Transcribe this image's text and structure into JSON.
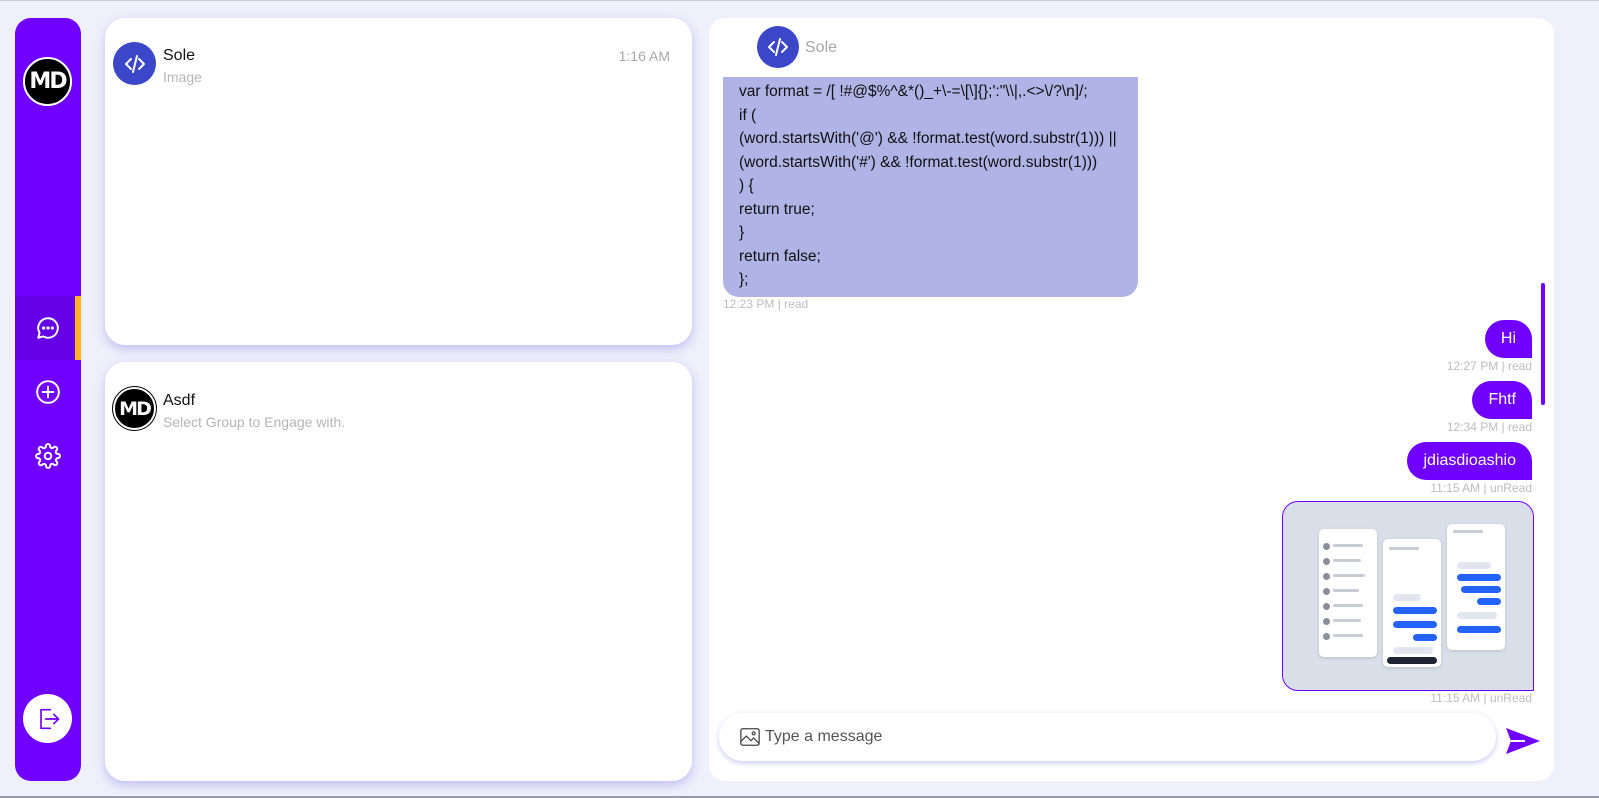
{
  "sidebar": {
    "logo_text": "MD",
    "items": [
      {
        "name": "chat-icon",
        "active": true
      },
      {
        "name": "add-circle-icon",
        "active": false
      },
      {
        "name": "gear-icon",
        "active": false
      }
    ],
    "logout_icon": "logout-icon",
    "colors": {
      "bg": "#7000ff",
      "active_indicator": "#ffb21f"
    }
  },
  "groups": [
    {
      "name": "Sole",
      "subtitle": "Image",
      "time": "1:16 AM",
      "avatar_icon": "code-icon"
    },
    {
      "name": "Asdf",
      "subtitle": "Select Group to Engage with.",
      "time": "",
      "avatar_text": "MD"
    }
  ],
  "chat": {
    "header_name": "Sole",
    "header_avatar_icon": "code-icon",
    "code_lines": [
      "var format = /[ !#@$%^&*()_+\\-=\\[\\]{};':\"\\\\|,.<>\\/?\\n]/;",
      "if (",
      "(word.startsWith('@') && !format.test(word.substr(1))) ||",
      "(word.startsWith('#') && !format.test(word.substr(1)))",
      ") {",
      "return true;",
      "}",
      "return false;",
      "};"
    ],
    "code_meta": "12:23 PM | read",
    "outgoing": [
      {
        "text": "Hi",
        "meta": "12:27 PM | read"
      },
      {
        "text": "Fhtf",
        "meta": "12:34 PM | read"
      },
      {
        "text": "jdiasdioashio",
        "meta": "11:15 AM | unRead"
      }
    ],
    "image_meta": "11:15 AM | unRead",
    "composer_placeholder": "Type a message",
    "accent": "#7000ff"
  }
}
